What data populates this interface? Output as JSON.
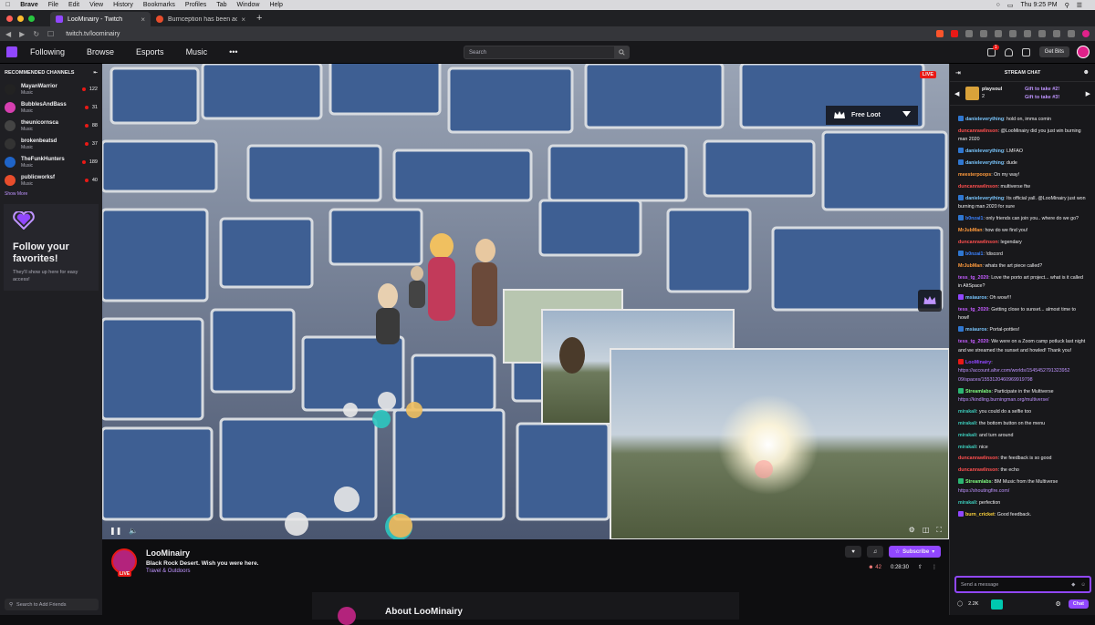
{
  "mac": {
    "app": "Brave",
    "menu": [
      "File",
      "Edit",
      "View",
      "History",
      "Bookmarks",
      "Profiles",
      "Tab",
      "Window",
      "Help"
    ],
    "clock": "Thu 9:25 PM"
  },
  "tabs": [
    {
      "title": "LooMinairy - Twitch",
      "active": true
    },
    {
      "title": "Burnception has been accomplis",
      "active": false
    }
  ],
  "address": {
    "url": "twitch.tv/loominairy"
  },
  "topnav": {
    "following": "Following",
    "browse": "Browse",
    "esports": "Esports",
    "music": "Music",
    "more": "•••",
    "search_placeholder": "Search",
    "notif_count": "1",
    "prime_count": "2",
    "get_bits": "Get Bits"
  },
  "sidebar": {
    "heading": "RECOMMENDED CHANNELS",
    "channels": [
      {
        "name": "MayanWarrior",
        "category": "Music",
        "viewers": "122",
        "color": "#222222"
      },
      {
        "name": "BubblesAndBass",
        "category": "Music",
        "viewers": "31",
        "color": "#d63fb0"
      },
      {
        "name": "theunicornsca",
        "category": "Music",
        "viewers": "88",
        "color": "#444444"
      },
      {
        "name": "brokenbeatsd",
        "category": "Music",
        "viewers": "37",
        "color": "#333333"
      },
      {
        "name": "TheFunkHunters",
        "category": "Music",
        "viewers": "189",
        "color": "#1f64c8"
      },
      {
        "name": "publicworksf",
        "category": "Music",
        "viewers": "40",
        "color": "#e84d2c"
      }
    ],
    "show_more": "Show More",
    "follow_title": "Follow your favorites!",
    "follow_desc": "They'll show up here for easy access!",
    "add_friends": "Search to Add Friends"
  },
  "video": {
    "live": "LIVE",
    "free_loot": "Free Loot"
  },
  "stream": {
    "name": "LooMinairy",
    "live": "LIVE",
    "title": "Black Rock Desert. Wish you were here.",
    "category": "Travel & Outdoors",
    "subscribe": "Subscribe",
    "viewers": "42",
    "uptime": "0:28:30",
    "about": "About LooMinairy"
  },
  "chat": {
    "heading": "STREAM CHAT",
    "gift_user": "playsoul",
    "gift_count": "2",
    "gift1": "Gift to take #2!",
    "gift2": "Gift to take #3!",
    "messages": [
      {
        "user": "danieleverything",
        "color": "#7ac7ff",
        "text": "hold on, imma comin",
        "badge": "#2f77d1"
      },
      {
        "user": "duncanrawlinson",
        "color": "#ff4f4f",
        "text": "@LooMinairy did you just win burning man 2020"
      },
      {
        "user": "danieleverything",
        "color": "#7ac7ff",
        "text": "LMFAO",
        "badge": "#2f77d1"
      },
      {
        "user": "danieleverything",
        "color": "#7ac7ff",
        "text": "dude",
        "badge": "#2f77d1"
      },
      {
        "user": "meesterpoops",
        "color": "#ff9a3c",
        "text": "On my way!"
      },
      {
        "user": "duncanrawlinson",
        "color": "#ff4f4f",
        "text": "multiverse ftw"
      },
      {
        "user": "danieleverything",
        "color": "#7ac7ff",
        "text": "Its official yall. @LooMinairy just won burning man 2020 for sure",
        "badge": "#2f77d1"
      },
      {
        "user": "b0nzai1",
        "color": "#3b82ff",
        "text": "only friends can join you.. where do we go?",
        "badge": "#2f77d1"
      },
      {
        "user": "MrJubMan",
        "color": "#ff9a3c",
        "text": "how do we find you!"
      },
      {
        "user": "duncanrawlinson",
        "color": "#ff4f4f",
        "text": "legendary"
      },
      {
        "user": "b0nzai1",
        "color": "#3b82ff",
        "text": "!discord",
        "badge": "#2f77d1"
      },
      {
        "user": "MrJubMan",
        "color": "#ff9a3c",
        "text": "whats the art piece called?"
      },
      {
        "user": "tess_tg_2020",
        "color": "#c45cff",
        "text": "Love the porto art project... what is it called in AltSpace?"
      },
      {
        "user": "msiauros",
        "color": "#7ac7ff",
        "text": "Oh wow!!!",
        "badge": "#9147ff"
      },
      {
        "user": "tess_tg_2020",
        "color": "#c45cff",
        "text": "Getting close to sunset... almost time to howl!"
      },
      {
        "user": "msiauros",
        "color": "#7ac7ff",
        "text": "Portal-potties!",
        "badge": "#2f77d1"
      },
      {
        "user": "tess_tg_2020",
        "color": "#c45cff",
        "text": "We were on a Zoom camp potluck last night and we streamed the sunset and howled! Thank you!"
      },
      {
        "user": "LooMinairy",
        "color": "#9147ff",
        "text": "",
        "link": "https://account.altvr.com/worlds/1545452791323952 09/spaces/1553120460969919798",
        "badge": "#e91916"
      },
      {
        "user": "Streamlabs",
        "color": "#80ff80",
        "text": "Participate in the Multiverse",
        "link": "https://kindling.burningman.org/multiverse/",
        "badge": "#2bb673"
      },
      {
        "user": "mirakali",
        "color": "#3bc9b9",
        "text": "you could do a selfie too"
      },
      {
        "user": "mirakali",
        "color": "#3bc9b9",
        "text": "the bottom button on the menu"
      },
      {
        "user": "mirakali",
        "color": "#3bc9b9",
        "text": "and turn around"
      },
      {
        "user": "mirakali",
        "color": "#3bc9b9",
        "text": "nice"
      },
      {
        "user": "duncanrawlinson",
        "color": "#ff4f4f",
        "text": "the feedback is so good"
      },
      {
        "user": "duncanrawlinson",
        "color": "#ff4f4f",
        "text": "the echo"
      },
      {
        "user": "Streamlabs",
        "color": "#80ff80",
        "text": "BM Music from the Multiverse",
        "link": "https://shoutingfire.com/",
        "badge": "#2bb673"
      },
      {
        "user": "mirakali",
        "color": "#3bc9b9",
        "text": "perfection"
      },
      {
        "user": "burn_cricket",
        "color": "#ffd43b",
        "text": "Good feedback.",
        "badge": "#9147ff"
      }
    ],
    "input_placeholder": "Send a message",
    "points": "2.2K",
    "chat_button": "Chat"
  }
}
